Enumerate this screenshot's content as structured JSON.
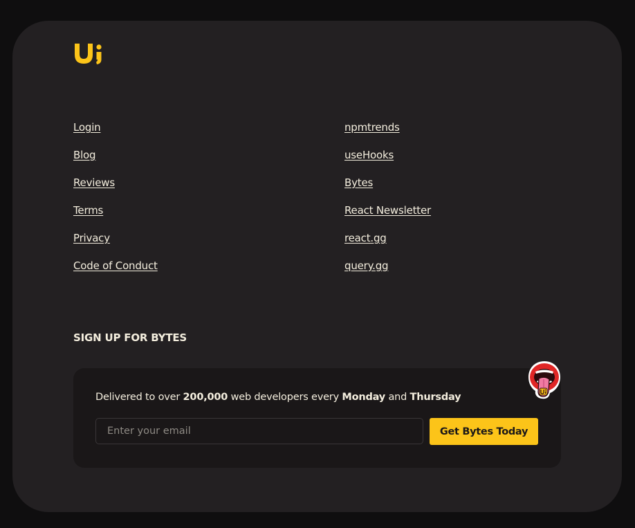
{
  "brand": {
    "logo_text": "Ui",
    "accent_color": "#fcc419",
    "text_color": "#f4eede"
  },
  "links": {
    "left": [
      "Login",
      "Blog",
      "Reviews",
      "Terms",
      "Privacy",
      "Code of Conduct"
    ],
    "right": [
      "npmtrends",
      "useHooks",
      "Bytes",
      "React Newsletter",
      "react.gg",
      "query.gg"
    ]
  },
  "signup": {
    "heading": "SIGN UP FOR BYTES",
    "text_prefix": "Delivered to over ",
    "subscriber_count": "200,000",
    "text_middle": " web developers every ",
    "day_one": "Monday",
    "text_and": " and ",
    "day_two": "Thursday",
    "email_placeholder": "Enter your email",
    "email_value": "",
    "button_label": "Get Bytes Today",
    "sticker_icon": "mouth-tongue-sticker-icon"
  }
}
